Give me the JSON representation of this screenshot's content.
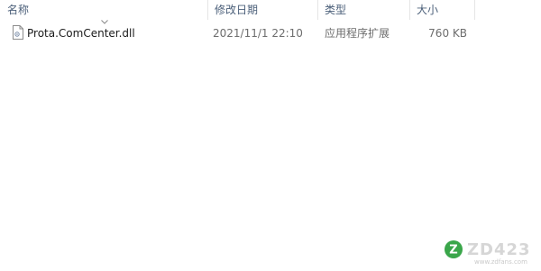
{
  "columns": {
    "name": "名称",
    "modified": "修改日期",
    "type": "类型",
    "size": "大小"
  },
  "files": [
    {
      "name": "Prota.ComCenter.dll",
      "modified": "2021/11/1 22:10",
      "type": "应用程序扩展",
      "size": "760 KB",
      "icon": "dll-file-icon"
    }
  ],
  "watermark": {
    "brand": "ZD423",
    "url": "www.zdfans.com",
    "logo_letter": "Z"
  },
  "colors": {
    "header_text": "#4c607a",
    "detail_text": "#6d6d6d",
    "watermark_green": "#3aa64a"
  }
}
